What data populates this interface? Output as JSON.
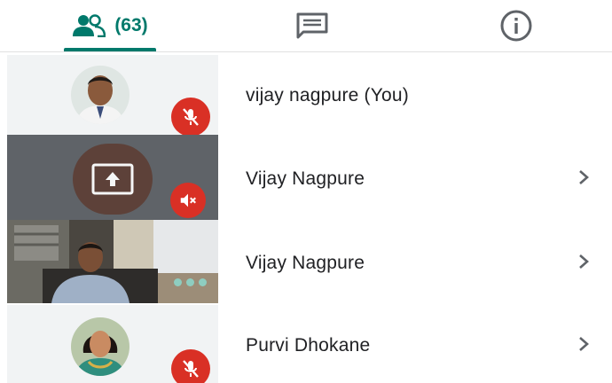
{
  "tabs": {
    "people_count": "(63)",
    "icons": [
      "people-icon",
      "chat-icon",
      "info-icon"
    ],
    "active_color": "#00796b"
  },
  "participants": [
    {
      "name": "vijay nagpure (You)",
      "thumb": "avatar",
      "mic": "muted"
    },
    {
      "name": "Vijay Nagpure",
      "thumb": "presenting",
      "mic": "muted"
    },
    {
      "name": "Vijay Nagpure",
      "thumb": "video",
      "mic": "speaking"
    },
    {
      "name": "Purvi Dhokane",
      "thumb": "avatar",
      "mic": "muted"
    }
  ],
  "colors": {
    "muted_badge": "#d93025",
    "text": "#202124",
    "speaking_dots": "#8ecdc0"
  }
}
